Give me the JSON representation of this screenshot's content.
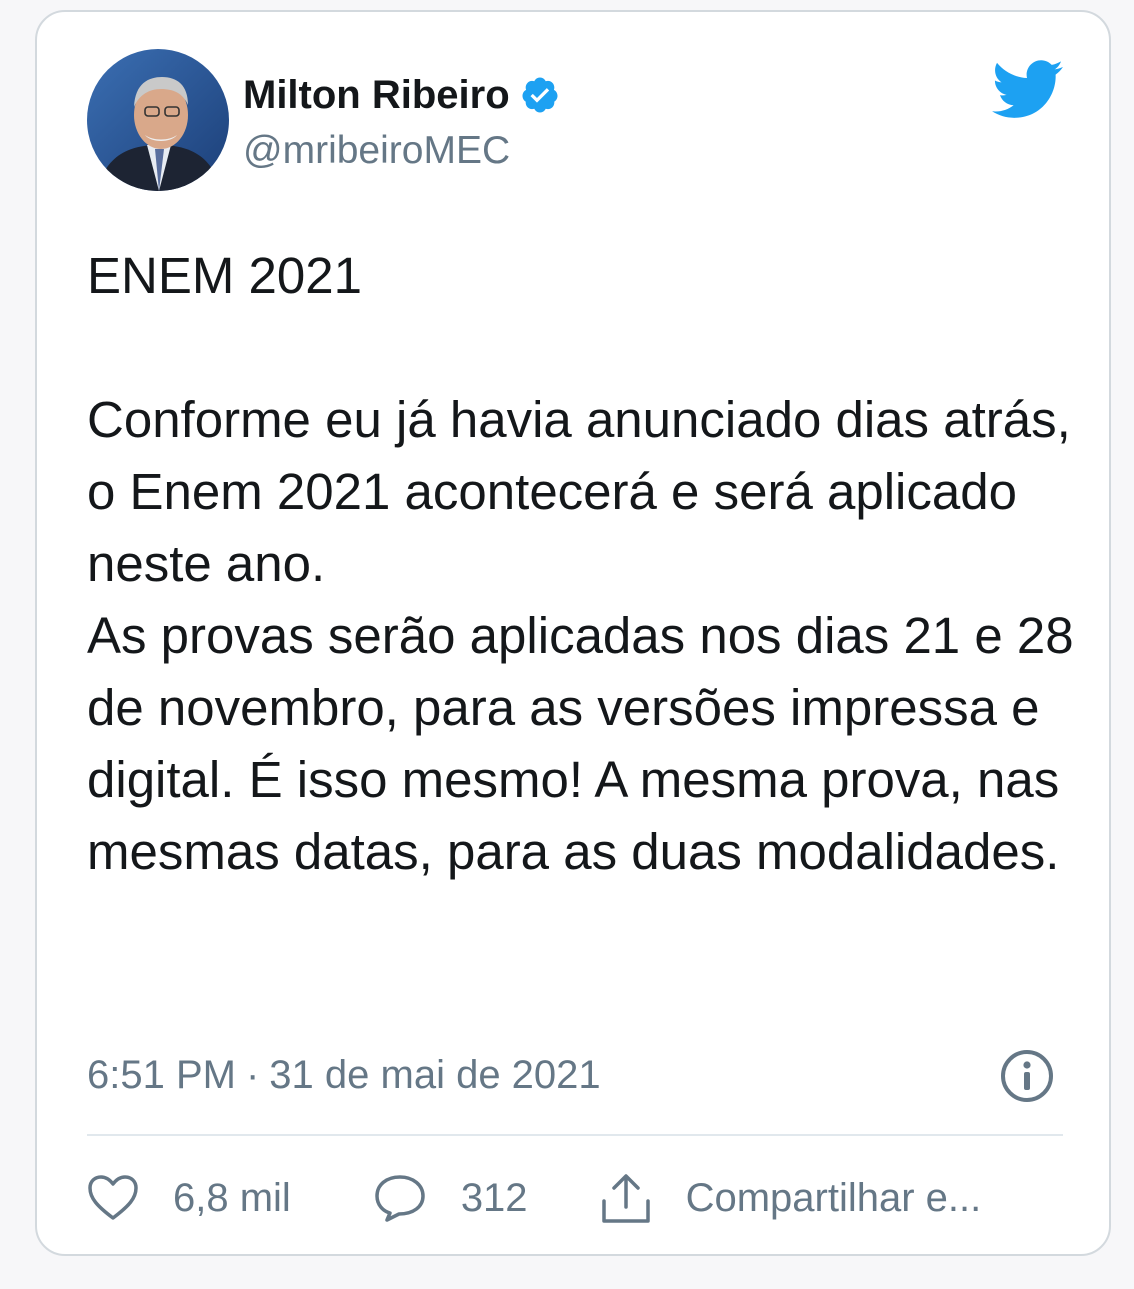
{
  "user": {
    "display_name": "Milton Ribeiro",
    "handle": "@mribeiroMEC",
    "verified": true
  },
  "tweet": {
    "text": "ENEM 2021\n\nConforme eu já havia anunciado dias atrás, o Enem 2021 acontecerá e será aplicado neste ano.\nAs provas serão aplicadas nos dias 21 e 28 de novembro, para as versões impressa e digital. É isso mesmo! A mesma prova, nas mesmas datas, para as duas modalidades.",
    "time": "6:51 PM",
    "separator": "·",
    "date": "31 de mai de 2021"
  },
  "actions": {
    "likes": "6,8 mil",
    "replies": "312",
    "share": "Compartilhar e..."
  },
  "colors": {
    "brand_blue": "#1da1f2",
    "text_primary": "#14171a",
    "text_secondary": "#657786",
    "border": "#d3d9de"
  },
  "icons": {
    "avatar": "avatar-photo",
    "verified": "verified-badge-icon",
    "logo": "twitter-bird-icon",
    "info": "info-icon",
    "like": "heart-icon",
    "reply": "speech-bubble-icon",
    "share": "share-icon"
  }
}
